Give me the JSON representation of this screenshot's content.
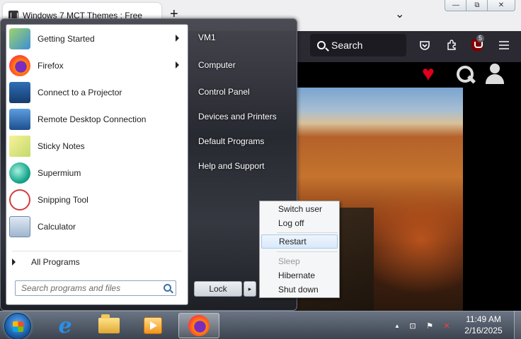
{
  "browser": {
    "tab_title": "Windows 7 MCT Themes : Free",
    "new_tab": "+",
    "tab_list": "⌄",
    "window_min": "—",
    "window_max": "⧉",
    "window_close": "✕",
    "search_placeholder": "Search",
    "ublock_badge": "5"
  },
  "start_menu": {
    "programs": [
      {
        "label": "Getting Started",
        "icon": "getting-started-icon",
        "has_arrow": true
      },
      {
        "label": "Firefox",
        "icon": "firefox-icon",
        "has_arrow": true
      },
      {
        "label": "Connect to a Projector",
        "icon": "projector-icon",
        "has_arrow": false
      },
      {
        "label": "Remote Desktop Connection",
        "icon": "remote-desktop-icon",
        "has_arrow": false
      },
      {
        "label": "Sticky Notes",
        "icon": "sticky-notes-icon",
        "has_arrow": false
      },
      {
        "label": "Supermium",
        "icon": "supermium-icon",
        "has_arrow": false
      },
      {
        "label": "Snipping Tool",
        "icon": "snipping-tool-icon",
        "has_arrow": false
      },
      {
        "label": "Calculator",
        "icon": "calculator-icon",
        "has_arrow": false
      }
    ],
    "all_programs": "All Programs",
    "search_placeholder": "Search programs and files",
    "right_links": [
      "VM1",
      "Computer",
      "Control Panel",
      "Devices and Printers",
      "Default Programs",
      "Help and Support"
    ],
    "lock_button": "Lock",
    "lock_arrow": "▸"
  },
  "power_menu": {
    "items": [
      {
        "label": "Switch user",
        "state": "normal"
      },
      {
        "label": "Log off",
        "state": "normal"
      },
      {
        "label": "Restart",
        "state": "selected"
      },
      {
        "label": "Sleep",
        "state": "disabled"
      },
      {
        "label": "Hibernate",
        "state": "normal"
      },
      {
        "label": "Shut down",
        "state": "normal"
      }
    ]
  },
  "taskbar": {
    "clock_time": "11:49 AM",
    "clock_date": "2/16/2025",
    "tray_up": "▲",
    "tray_network": "⊡",
    "tray_flag": "⚑",
    "tray_volume": "✕"
  },
  "colors": {
    "heart": "#e0001a",
    "accent_blue": "#2b8ee6",
    "selected_item_bg": "#d9e9fb"
  }
}
